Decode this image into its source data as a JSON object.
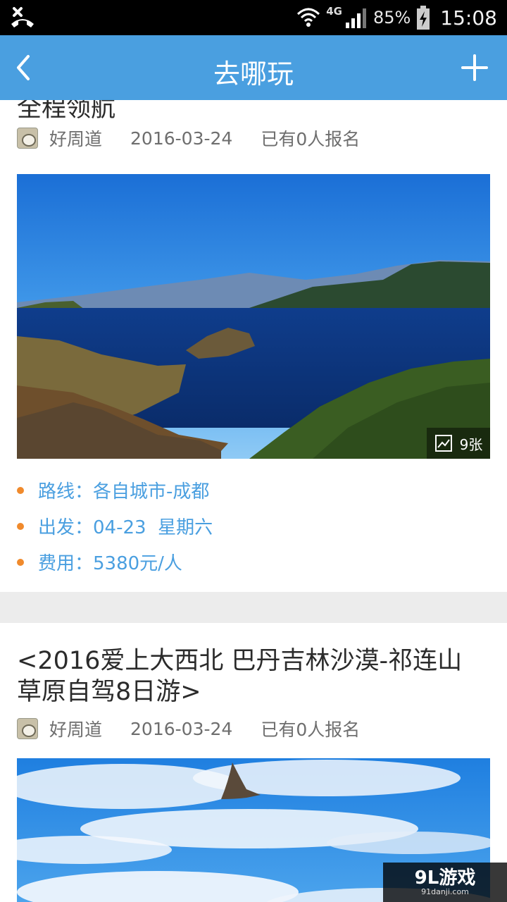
{
  "status_bar": {
    "network": "4G",
    "battery": "85%",
    "time": "15:08"
  },
  "header": {
    "title": "去哪玩"
  },
  "trips": [
    {
      "title": "全程领航",
      "organizer": "好周道",
      "date": "2016-03-24",
      "signups": "已有0人报名",
      "photo_count": "9张",
      "route": "路线：各自城市-成都",
      "departure": "出发：04-23  星期六",
      "cost": "费用：5380元/人"
    },
    {
      "title": "<2016爱上大西北 巴丹吉林沙漠-祁连山草原自驾8日游>",
      "organizer": "好周道",
      "date": "2016-03-24",
      "signups": "已有0人报名"
    }
  ],
  "watermark": {
    "main": "9L游戏",
    "sub": "91danji.com"
  },
  "colors": {
    "header_bg": "#4a9fe0",
    "info_text": "#4a9fe0",
    "bullet": "#f08a2c"
  }
}
